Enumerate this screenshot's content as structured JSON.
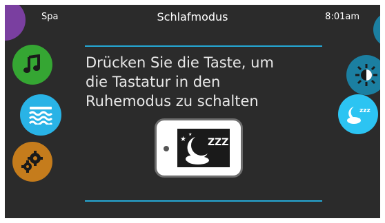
{
  "header": {
    "left_label": "Spa",
    "title": "Schlafmodus",
    "time": "8:01am"
  },
  "message": {
    "line1": "Drücken Sie die Taste, um",
    "line2": "die Tastatur in den",
    "line3": "Ruhemodus zu schalten"
  },
  "left_nav": [
    {
      "icon": "spa-icon",
      "color": "#7a3fa0"
    },
    {
      "icon": "music-note-icon",
      "color": "#35a633"
    },
    {
      "icon": "water-waves-icon",
      "color": "#29b3e6"
    },
    {
      "icon": "gears-icon",
      "color": "#c57c1c"
    }
  ],
  "right_nav": [
    {
      "icon": "settings-icon",
      "color": "#1b7fa1"
    },
    {
      "icon": "brightness-icon",
      "color": "#1b7fa1"
    },
    {
      "icon": "sleep-mode-icon",
      "color": "#2cc4f2"
    }
  ],
  "sleep_button": {
    "icon": "sleep-mode-icon",
    "zzz": "ZZZ"
  },
  "colors": {
    "accent": "#25a9d6",
    "background": "#2b2b2b"
  }
}
